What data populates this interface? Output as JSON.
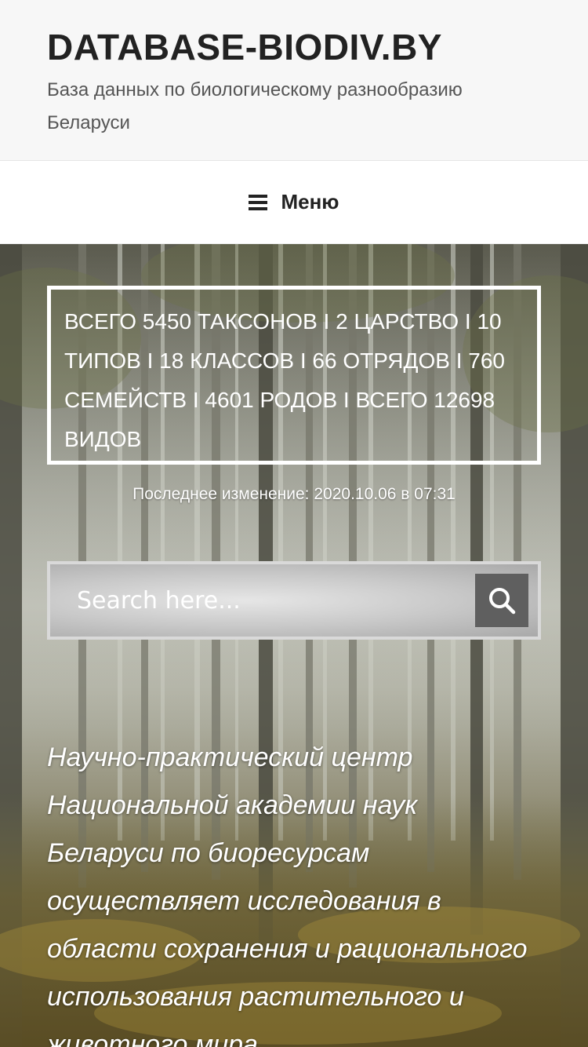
{
  "header": {
    "site_title": "DATABASE-BIODIV.BY",
    "site_description": "База данных по биологическому разнообразию Беларуси"
  },
  "nav": {
    "menu_icon": "hamburger-icon",
    "menu_label": "Меню"
  },
  "hero": {
    "taxa_summary": "ВСЕГО 5450 ТАКСОНОВ I 2 ЦАРСТВО I 10 ТИПОВ I 18 КЛАССОВ I 66 ОТРЯДОВ I 760 СЕМЕЙСТВ I 4601 РОДОВ I ВСЕГО 12698 ВИДОВ",
    "last_modified": "Последнее изменение: 2020.10.06 в 07:31"
  },
  "search": {
    "placeholder": "Search here...",
    "button_icon": "search-icon"
  },
  "intro": {
    "text": "Научно-практический центр Национальной академии наук Беларуси по биоресурсам осуществляет исследования в области сохранения и рационального использования растительного и животного мира"
  },
  "colors": {
    "header_bg": "#f7f7f7",
    "title": "#222222",
    "description": "#555555",
    "search_button": "#5f5f5f"
  }
}
